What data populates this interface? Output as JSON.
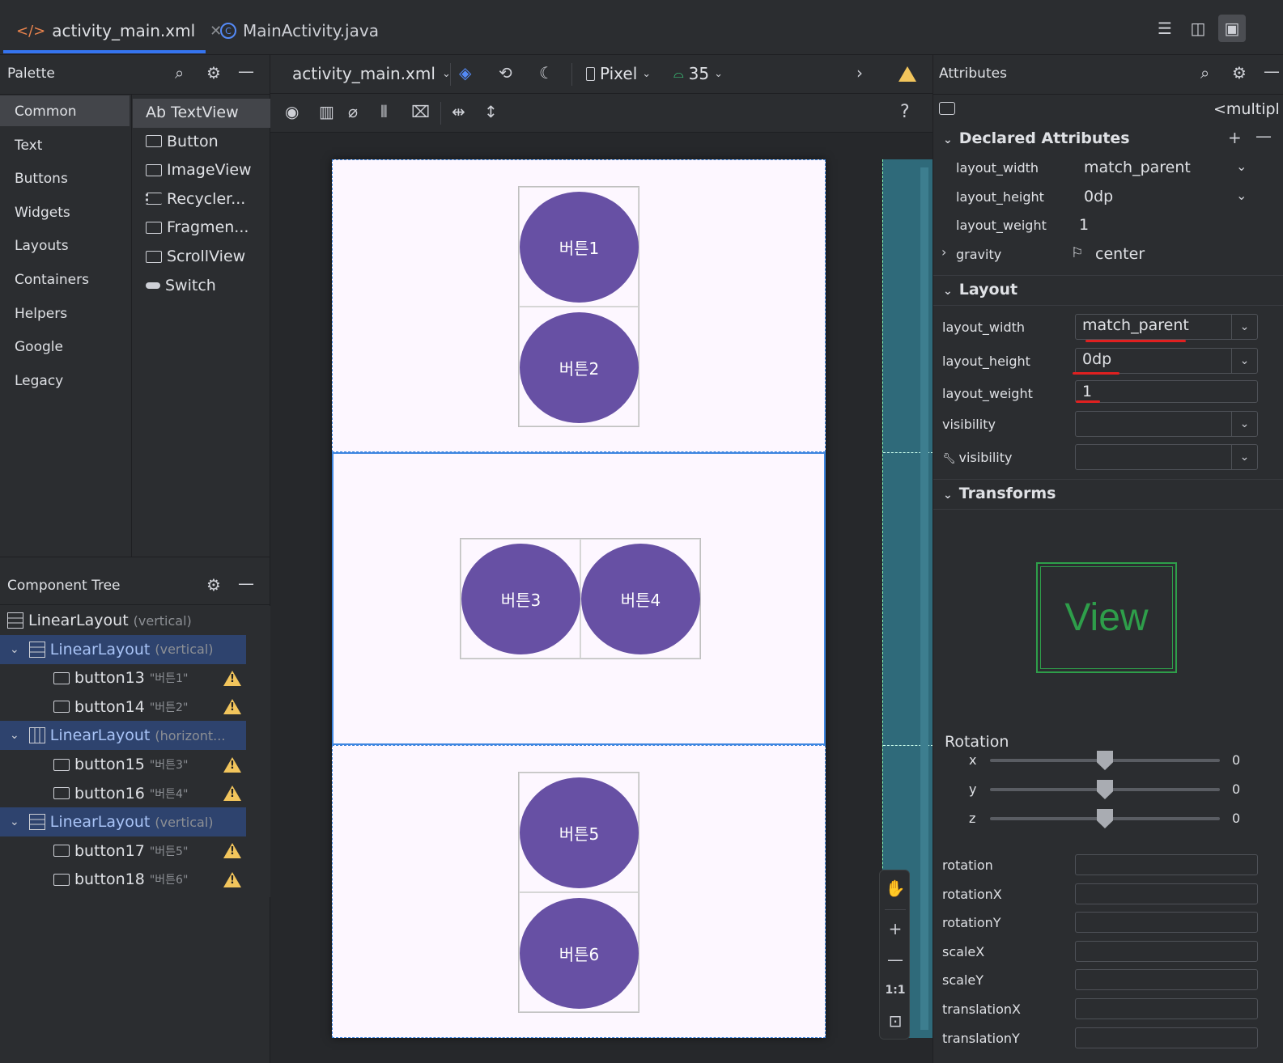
{
  "tabs": [
    {
      "label": "activity_main.xml",
      "icon": "xml-icon",
      "active": true
    },
    {
      "label": "MainActivity.java",
      "icon": "class-icon",
      "active": false
    }
  ],
  "palette": {
    "title": "Palette",
    "categories": [
      "Common",
      "Text",
      "Buttons",
      "Widgets",
      "Layouts",
      "Containers",
      "Helpers",
      "Google",
      "Legacy"
    ],
    "items": [
      {
        "label": "Ab TextView",
        "icon": "textview-icon"
      },
      {
        "label": "Button",
        "icon": "button-icon"
      },
      {
        "label": "ImageView",
        "icon": "imageview-icon"
      },
      {
        "label": "Recycler...",
        "icon": "recyclerview-icon"
      },
      {
        "label": "Fragmen...",
        "icon": "fragment-icon"
      },
      {
        "label": "ScrollView",
        "icon": "scrollview-icon"
      },
      {
        "label": "Switch",
        "icon": "switch-icon"
      }
    ]
  },
  "tree": {
    "title": "Component Tree",
    "rows": [
      {
        "name": "LinearLayout",
        "meta": "(vertical)",
        "indent": 0,
        "selected": false,
        "warn": false,
        "hint": ""
      },
      {
        "name": "LinearLayout",
        "meta": "(vertical)",
        "indent": 1,
        "selected": true,
        "warn": false,
        "hint": ""
      },
      {
        "name": "button13",
        "meta": "",
        "indent": 2,
        "selected": false,
        "warn": true,
        "hint": "\"버튼1\""
      },
      {
        "name": "button14",
        "meta": "",
        "indent": 2,
        "selected": false,
        "warn": true,
        "hint": "\"버튼2\""
      },
      {
        "name": "LinearLayout",
        "meta": "(horizont...",
        "indent": 1,
        "selected": true,
        "warn": false,
        "hint": ""
      },
      {
        "name": "button15",
        "meta": "",
        "indent": 2,
        "selected": false,
        "warn": true,
        "hint": "\"버튼3\""
      },
      {
        "name": "button16",
        "meta": "",
        "indent": 2,
        "selected": false,
        "warn": true,
        "hint": "\"버튼4\""
      },
      {
        "name": "LinearLayout",
        "meta": "(vertical)",
        "indent": 1,
        "selected": true,
        "warn": false,
        "hint": ""
      },
      {
        "name": "button17",
        "meta": "",
        "indent": 2,
        "selected": false,
        "warn": true,
        "hint": "\"버튼5\""
      },
      {
        "name": "button18",
        "meta": "",
        "indent": 2,
        "selected": false,
        "warn": true,
        "hint": "\"버튼6\""
      }
    ]
  },
  "editor": {
    "file_dropdown": "activity_main.xml",
    "device": "Pixel",
    "api": "35",
    "help": "?",
    "buttons": [
      "버튼1",
      "버튼2",
      "버튼3",
      "버튼4",
      "버튼5",
      "버튼6"
    ],
    "zoom_one_to_one": "1:1"
  },
  "attributes": {
    "title": "Attributes",
    "multi": "<multipl",
    "declared_title": "Declared Attributes",
    "declared": [
      {
        "key": "layout_width",
        "value": "match_parent"
      },
      {
        "key": "layout_height",
        "value": "0dp"
      },
      {
        "key": "layout_weight",
        "value": "1"
      },
      {
        "key": "gravity",
        "value": "center"
      }
    ],
    "layout_title": "Layout",
    "layout": [
      {
        "key": "layout_width",
        "value": "match_parent"
      },
      {
        "key": "layout_height",
        "value": "0dp"
      },
      {
        "key": "layout_weight",
        "value": "1"
      },
      {
        "key": "visibility",
        "value": ""
      },
      {
        "key": "visibility",
        "value": ""
      }
    ],
    "transforms_title": "Transforms",
    "view_preview": "View",
    "rotation_title": "Rotation",
    "rotation_axes": [
      {
        "axis": "x",
        "value": "0"
      },
      {
        "axis": "y",
        "value": "0"
      },
      {
        "axis": "z",
        "value": "0"
      }
    ],
    "transform_fields": [
      "rotation",
      "rotationX",
      "rotationY",
      "scaleX",
      "scaleY",
      "translationX",
      "translationY"
    ]
  },
  "colors": {
    "accent": "#3574f0",
    "button_fill": "#6750a4",
    "warning": "#f2c55c",
    "underline_red": "#e02020"
  }
}
